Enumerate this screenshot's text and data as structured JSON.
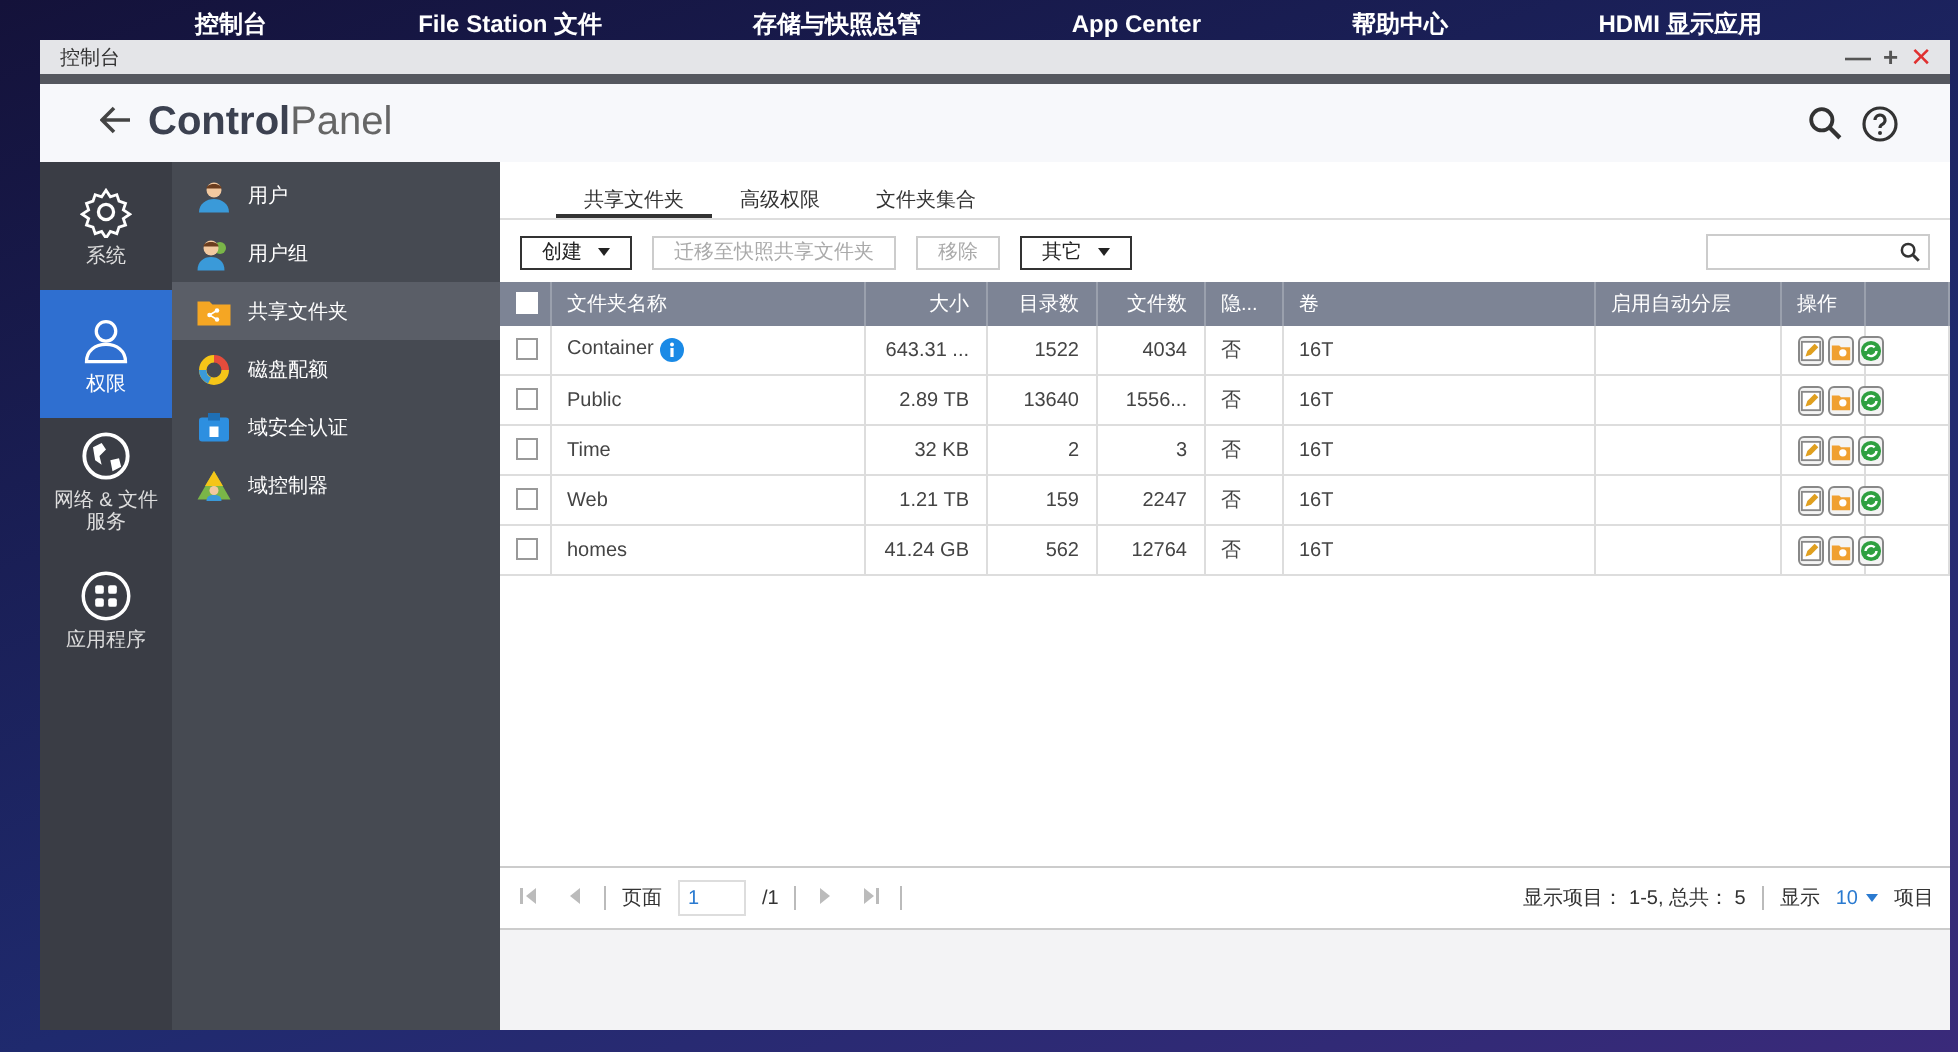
{
  "desktop": {
    "labels": [
      "控制台",
      "File Station 文件",
      "存储与快照总管",
      "App Center",
      "帮助中心",
      "HDMI 显示应用"
    ]
  },
  "window": {
    "title": "控制台",
    "controls": [
      "—",
      "+",
      "✕"
    ]
  },
  "header": {
    "title_bold": "Control",
    "title_light": "Panel"
  },
  "sidebar": {
    "items": [
      {
        "label": "系统",
        "selected": false
      },
      {
        "label": "权限",
        "selected": true
      },
      {
        "label": "网络 & 文件服务",
        "selected": false
      },
      {
        "label": "应用程序",
        "selected": false
      }
    ]
  },
  "submenu": {
    "items": [
      {
        "label": "用户",
        "selected": false
      },
      {
        "label": "用户组",
        "selected": false
      },
      {
        "label": "共享文件夹",
        "selected": true
      },
      {
        "label": "磁盘配额",
        "selected": false
      },
      {
        "label": "域安全认证",
        "selected": false
      },
      {
        "label": "域控制器",
        "selected": false
      }
    ]
  },
  "tabs": [
    {
      "label": "共享文件夹",
      "selected": true
    },
    {
      "label": "高级权限",
      "selected": false
    },
    {
      "label": "文件夹集合",
      "selected": false
    }
  ],
  "toolbar": [
    {
      "label": "创建",
      "dropdown": true,
      "disabled": false
    },
    {
      "label": "迁移至快照共享文件夹",
      "dropdown": false,
      "disabled": true
    },
    {
      "label": "移除",
      "dropdown": false,
      "disabled": true
    },
    {
      "label": "其它",
      "dropdown": true,
      "disabled": false
    }
  ],
  "table": {
    "header_checked": false,
    "columns": [
      "文件夹名称",
      "大小",
      "目录数",
      "文件数",
      "隐...",
      "卷",
      "启用自动分层",
      "操作"
    ],
    "rows": [
      {
        "checked": false,
        "name": "Container",
        "info": true,
        "size": "643.31 ...",
        "dirs": "1522",
        "files": "4034",
        "hidden": "否",
        "volume": "16T"
      },
      {
        "checked": false,
        "name": "Public",
        "info": false,
        "size": "2.89 TB",
        "dirs": "13640",
        "files": "1556...",
        "hidden": "否",
        "volume": "16T"
      },
      {
        "checked": false,
        "name": "Time",
        "info": false,
        "size": "32 KB",
        "dirs": "2",
        "files": "3",
        "hidden": "否",
        "volume": "16T"
      },
      {
        "checked": false,
        "name": "Web",
        "info": false,
        "size": "1.21 TB",
        "dirs": "159",
        "files": "2247",
        "hidden": "否",
        "volume": "16T"
      },
      {
        "checked": false,
        "name": "homes",
        "info": false,
        "size": "41.24 GB",
        "dirs": "562",
        "files": "12764",
        "hidden": "否",
        "volume": "16T"
      }
    ]
  },
  "pager": {
    "page_label": "页面",
    "page": "1",
    "total": "/1",
    "summary": "显示项目： 1-5, 总共： 5",
    "show_label": "显示",
    "per_page": "10",
    "items_label": "项目"
  }
}
